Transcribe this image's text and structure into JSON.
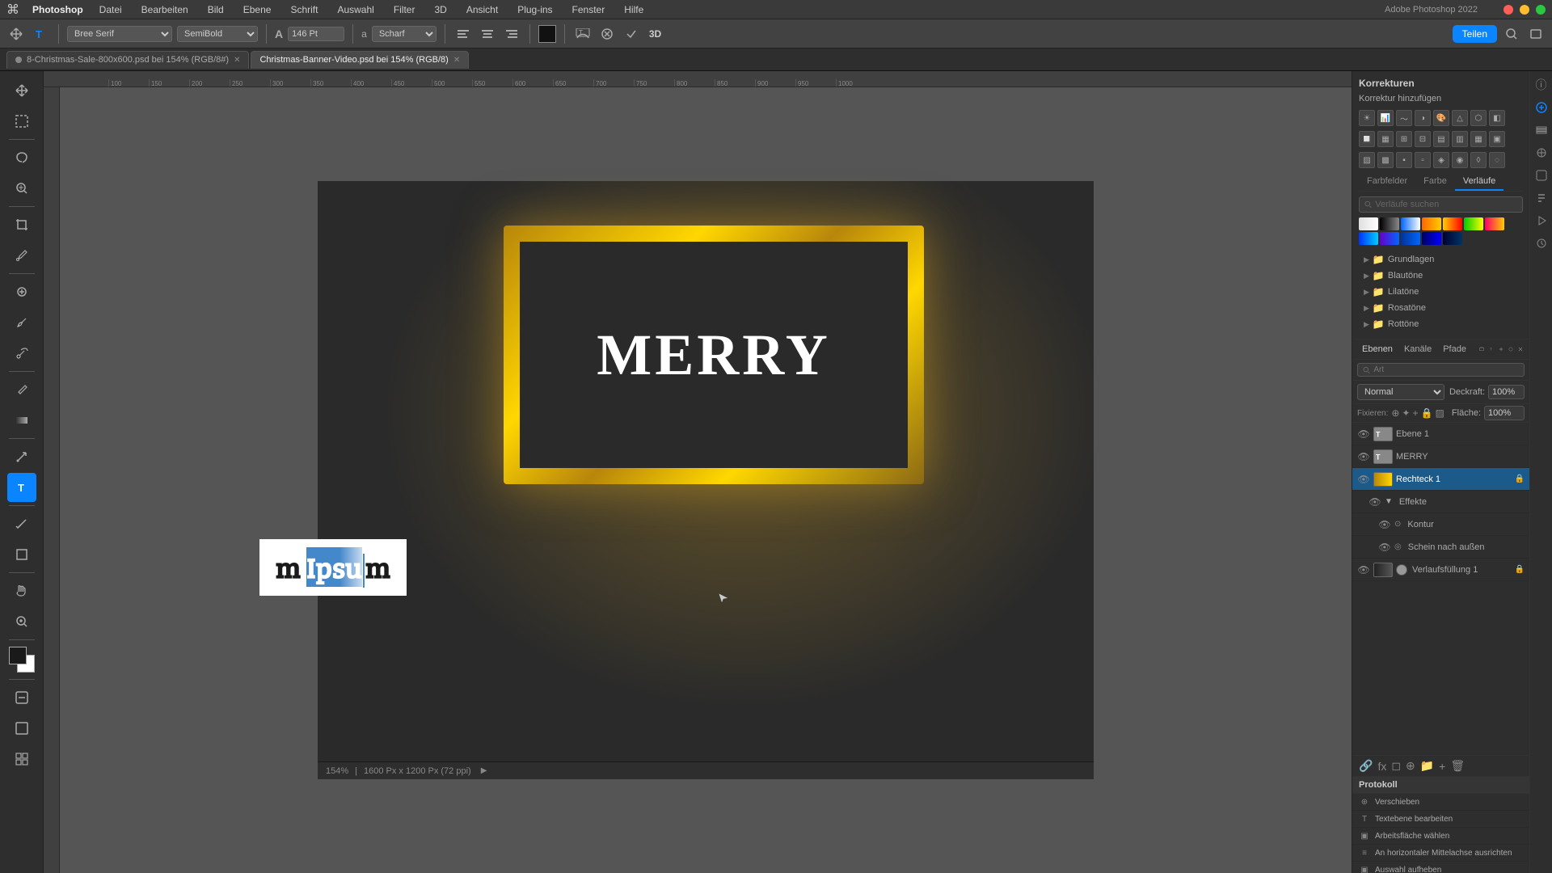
{
  "app": {
    "name": "Photoshop",
    "title": "Adobe Photoshop 2022"
  },
  "menubar": {
    "apple": "⌘",
    "app_name": "Photoshop",
    "items": [
      "Datei",
      "Bearbeiten",
      "Bild",
      "Ebene",
      "Schrift",
      "Auswahl",
      "Filter",
      "3D",
      "Ansicht",
      "Plug-ins",
      "Fenster",
      "Hilfe"
    ]
  },
  "toolbar": {
    "font_family": "Bree Serif",
    "font_style": "SemiBold",
    "font_size_icon": "A",
    "font_size": "146 Pt",
    "antialiasing_icon": "a",
    "antialiasing": "Scharf",
    "share_btn": "Teilen",
    "three_d": "3D"
  },
  "tabs": [
    {
      "label": "8-Christmas-Sale-800x600.psd bei 154% (RGB/8#)",
      "active": false
    },
    {
      "label": "Christmas-Banner-Video.psd bei 154% (RGB/8)",
      "active": true
    }
  ],
  "canvas": {
    "banner_text": "MERRY",
    "text_overlay": "m Ipsum",
    "zoom": "154%",
    "dimensions": "1600 Px x 1200 Px (72 ppi)"
  },
  "corrections_panel": {
    "title": "Korrekturen",
    "add_correction": "Korrektur hinzufügen",
    "tabs": [
      "Farbfelder",
      "Farbe",
      "Verläufe"
    ],
    "active_tab": "Verläufe",
    "search_placeholder": "Verläufe suchen",
    "folders": [
      {
        "label": "Grundlagen",
        "expanded": false
      },
      {
        "label": "Blautöne",
        "expanded": false
      },
      {
        "label": "Lilatöne",
        "expanded": false
      },
      {
        "label": "Rosatöne",
        "expanded": false
      },
      {
        "label": "Rottöne",
        "expanded": false
      }
    ]
  },
  "layers_panel": {
    "tabs": [
      "Ebenen",
      "Kanäle",
      "Pfade"
    ],
    "active_tab": "Ebenen",
    "blend_mode": "Normal",
    "opacity_label": "Deckraft:",
    "opacity_value": "100%",
    "fix_label": "Fixieren:",
    "fill_label": "Fläche:",
    "fill_value": "100%",
    "layers": [
      {
        "name": "Ebene 1",
        "type": "text",
        "visible": true,
        "selected": false
      },
      {
        "name": "MERRY",
        "type": "text",
        "visible": true,
        "selected": false
      },
      {
        "name": "Rechteck 1",
        "type": "rect",
        "visible": true,
        "selected": true
      },
      {
        "name": "Effekte",
        "type": "effect",
        "visible": true,
        "indent": 1
      },
      {
        "name": "Kontur",
        "type": "effect",
        "visible": true,
        "indent": 2
      },
      {
        "name": "Schein nach außen",
        "type": "effect",
        "visible": true,
        "indent": 2
      },
      {
        "name": "Verlaufsfüllung 1",
        "type": "gradient",
        "visible": true,
        "indent": 0
      }
    ]
  },
  "protocol_panel": {
    "title": "Protokoll",
    "items": [
      {
        "label": "Verschieben",
        "icon": "move"
      },
      {
        "label": "Textebene bearbeiten",
        "icon": "text"
      },
      {
        "label": "Arbeitsfläche wählen",
        "icon": "canvas"
      },
      {
        "label": "An horizontaler Mittelachse ausrichten",
        "icon": "align"
      },
      {
        "label": "Auswahl aufheben",
        "icon": "deselect"
      }
    ]
  },
  "status_bar": {
    "zoom": "154%",
    "dimensions": "1600 Px x 1200 Px (72 ppi)"
  }
}
